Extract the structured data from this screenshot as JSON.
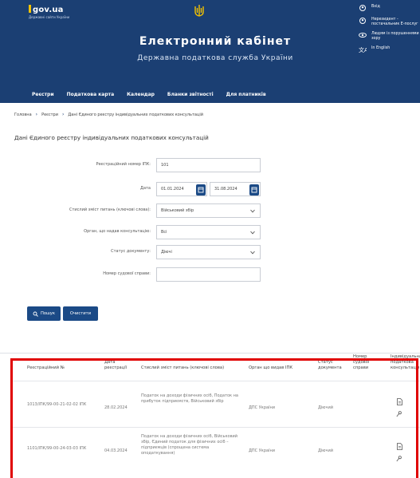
{
  "header": {
    "logo_title": "gov.ua",
    "logo_subtitle": "Державні сайти України",
    "main_title": "Електронний кабінет",
    "sub_title": "Державна податкова служба України",
    "right_menu": [
      "Вхід",
      "Нерезидент - постачальник Е-послуг",
      "Людям із порушеннями зору",
      "In English"
    ],
    "nav": [
      "Реєстри",
      "Податкова карта",
      "Календар",
      "Бланки звітності",
      "Для платників"
    ]
  },
  "breadcrumb": [
    "Головна",
    "Реєстри",
    "Дані Єдиного реєстру індивідуальних податкових консультацій"
  ],
  "page_title": "Дані Єдиного реєстру індивідуальних податкових консультацій",
  "form": {
    "reg_label": "Реєстраційний номер ІПК:",
    "reg_value": "101",
    "date_label": "Дата",
    "date_from": "01.01.2024",
    "date_to": "31.08.2024",
    "keywords_label": "Стислий зміст питань (ключові слова):",
    "keywords_value": "Військовий збір",
    "organ_label": "Орган, що надав консультацію:",
    "organ_value": "Всі",
    "status_label": "Статус документу:",
    "status_value": "Діючі",
    "court_label": "Номер судової справи:",
    "court_value": ""
  },
  "buttons": {
    "search": "Пошук",
    "clear": "Очистити"
  },
  "table": {
    "headers": [
      "Реєстраційний №",
      "Дата реєстрації",
      "Стислий зміст питань (ключові слова)",
      "Орган що видав ІПК",
      "Статус документа",
      "Номер судової справи",
      "Індивідуальна податкова консультація"
    ],
    "rows": [
      {
        "reg": "1013/ІПК/99-00-21-02-02 ІПК",
        "date": "28.02.2024",
        "summary": "Податок на доходи фізичних осіб, Податок на прибуток підприємств, Військовий збір",
        "organ": "ДПС України",
        "status": "Діючий"
      },
      {
        "reg": "1101/ІПК/99-00-24-03-03 ІПК",
        "date": "04.03.2024",
        "summary": "Податок на доходи фізичних осіб, Військовий збір, Єдиний податок для фізичних осіб – підприємців (спрощена система оподаткування)",
        "organ": "ДПС України",
        "status": "Діючий"
      }
    ]
  },
  "colors": {
    "header_bg": "#1b3f73",
    "button_bg": "#1b4a86",
    "highlight": "#e00000"
  }
}
